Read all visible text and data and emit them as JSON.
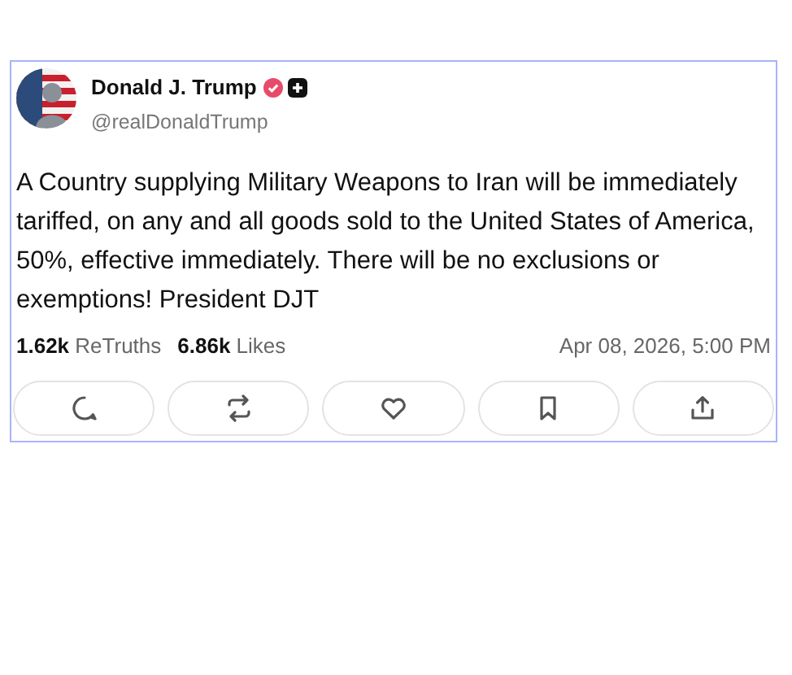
{
  "post": {
    "author": {
      "name": "Donald J. Trump",
      "handle": "@realDonaldTrump",
      "verified": true
    },
    "text": "A Country supplying Military Weapons to Iran will be immediately tariffed, on any and all goods sold to the United States of America, 50%, effective immediately. There will be no exclusions or exemptions! President DJT",
    "stats": [
      {
        "count": "1.62k",
        "label": "ReTruths"
      },
      {
        "count": "6.86k",
        "label": "Likes"
      }
    ],
    "timestamp": "Apr 08, 2026, 5:00 PM",
    "actions": [
      {
        "kind": "reply"
      },
      {
        "kind": "retruth"
      },
      {
        "kind": "like"
      },
      {
        "kind": "bookmark"
      },
      {
        "kind": "share"
      }
    ]
  }
}
